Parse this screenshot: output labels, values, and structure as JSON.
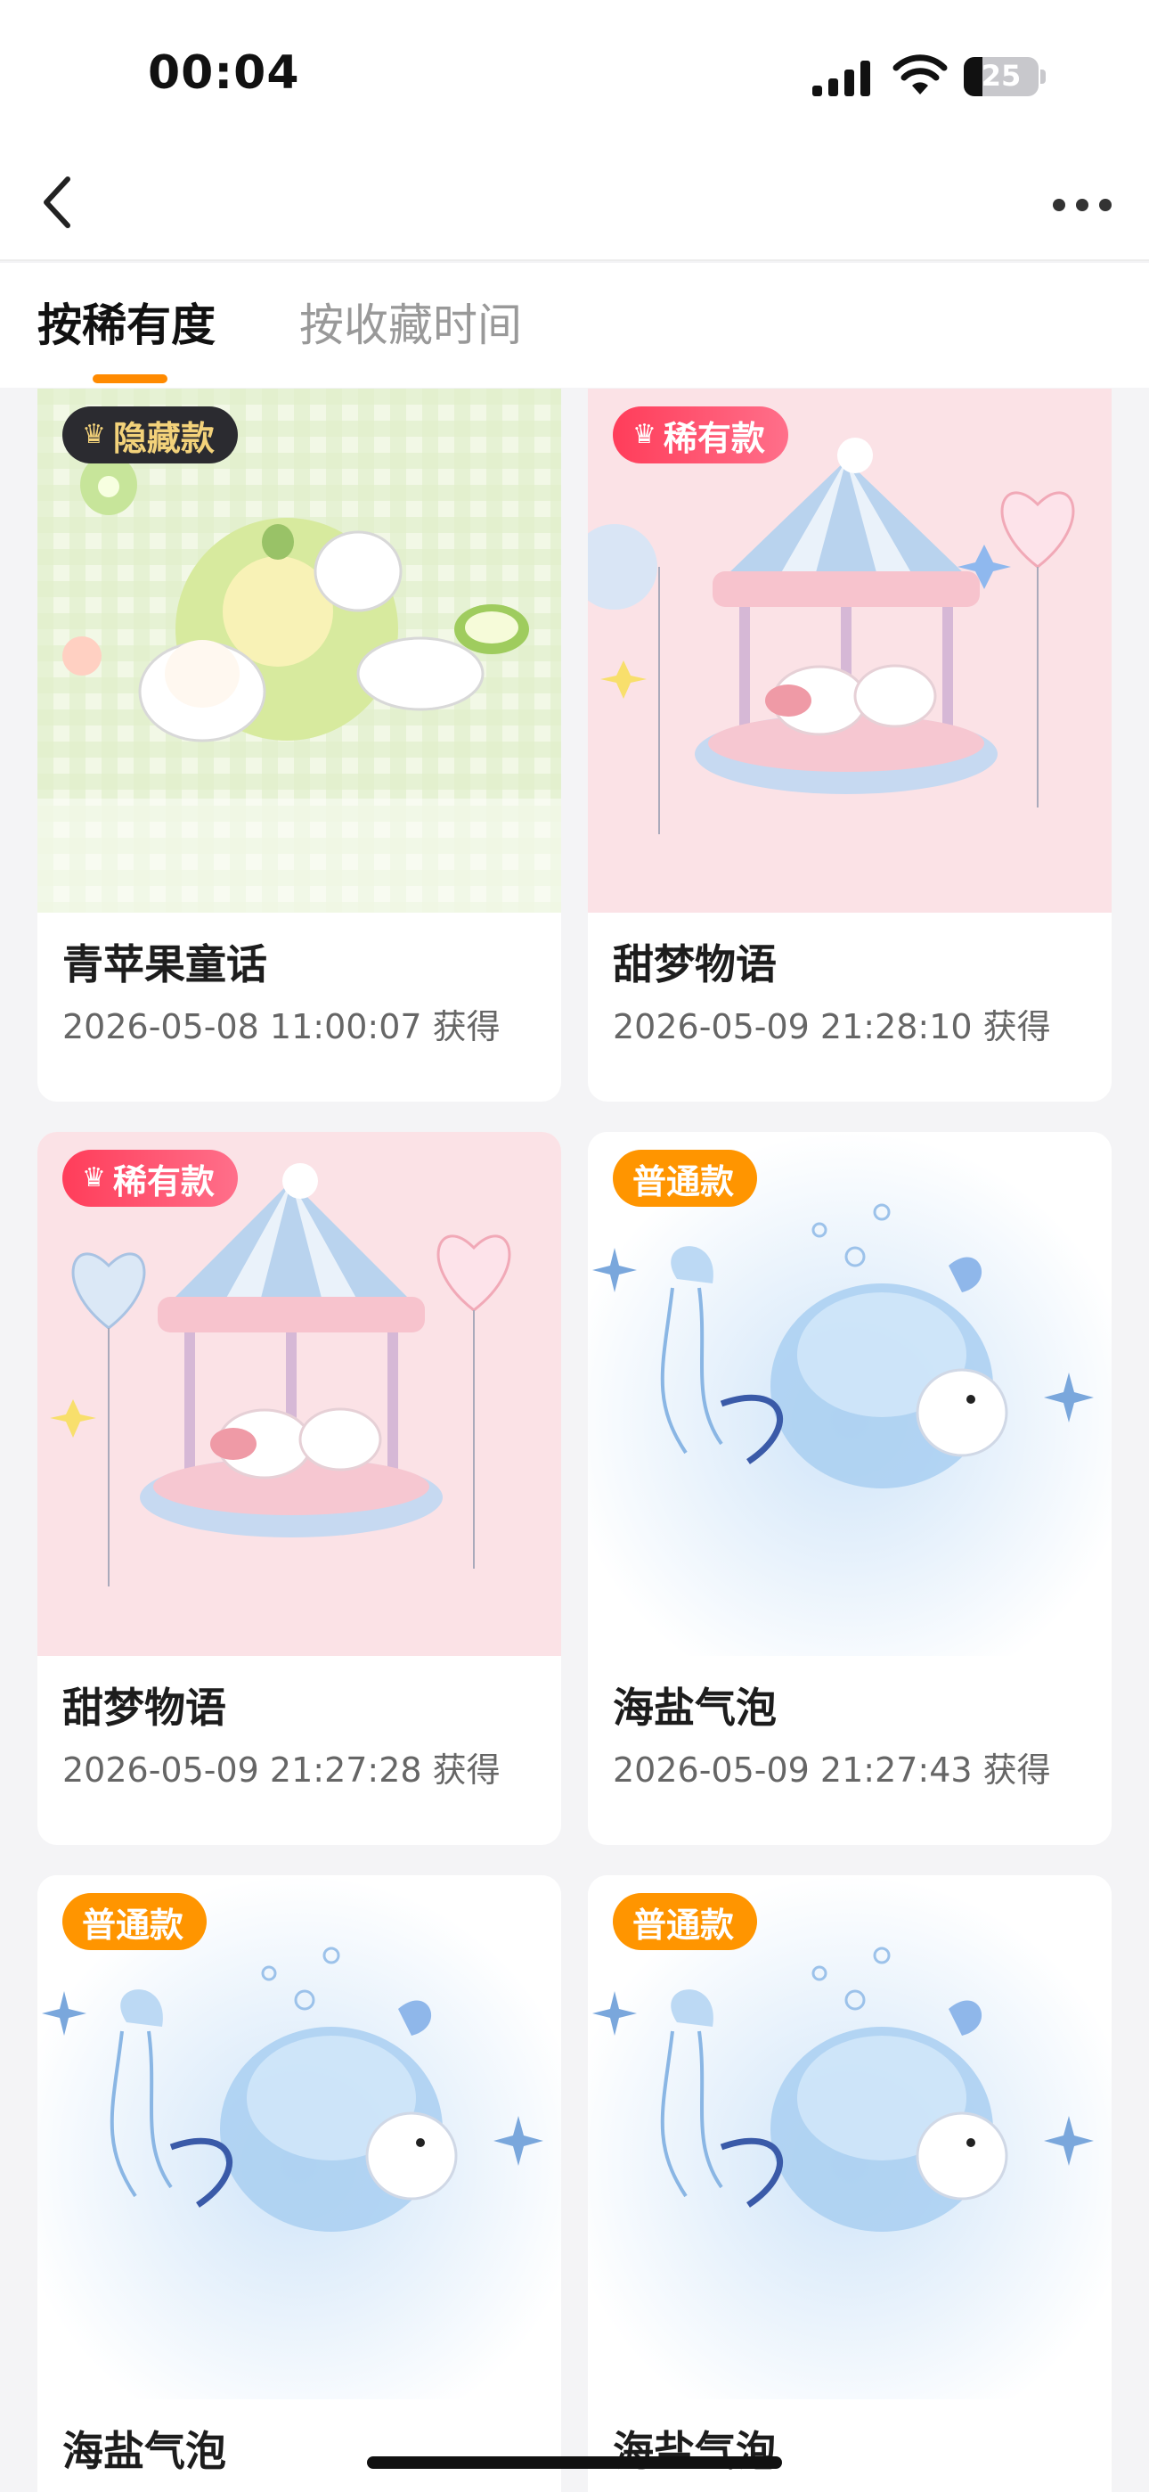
{
  "status_bar": {
    "time": "00:04",
    "battery": "25"
  },
  "nav": {
    "title": ""
  },
  "tabs": [
    {
      "label": "按稀有度",
      "active": true
    },
    {
      "label": "按收藏时间",
      "active": false
    }
  ],
  "cards": [
    {
      "badge": "隐藏款",
      "badge_type": "hidden",
      "name": "青苹果童话",
      "date": "2026-05-08 11:00:07 获得",
      "art": "apple-puppies"
    },
    {
      "badge": "稀有款",
      "badge_type": "rare",
      "name": "甜梦物语",
      "date": "2026-05-09 21:28:10 获得",
      "art": "carousel"
    },
    {
      "badge": "稀有款",
      "badge_type": "rare",
      "name": "甜梦物语",
      "date": "2026-05-09 21:27:28 获得",
      "art": "carousel"
    },
    {
      "badge": "普通款",
      "badge_type": "common",
      "name": "海盐气泡",
      "date": "2026-05-09 21:27:43 获得",
      "art": "jellyfish-bubble"
    },
    {
      "badge": "普通款",
      "badge_type": "common",
      "name": "海盐气泡",
      "date": "",
      "art": "jellyfish-bubble"
    },
    {
      "badge": "普通款",
      "badge_type": "common",
      "name": "海盐气泡",
      "date": "",
      "art": "jellyfish-bubble"
    }
  ],
  "colors": {
    "accent": "#ff8a00",
    "hidden_badge": "#2b2b30",
    "rare_badge": "#ff3d5a",
    "common_badge": "#ff9500"
  }
}
